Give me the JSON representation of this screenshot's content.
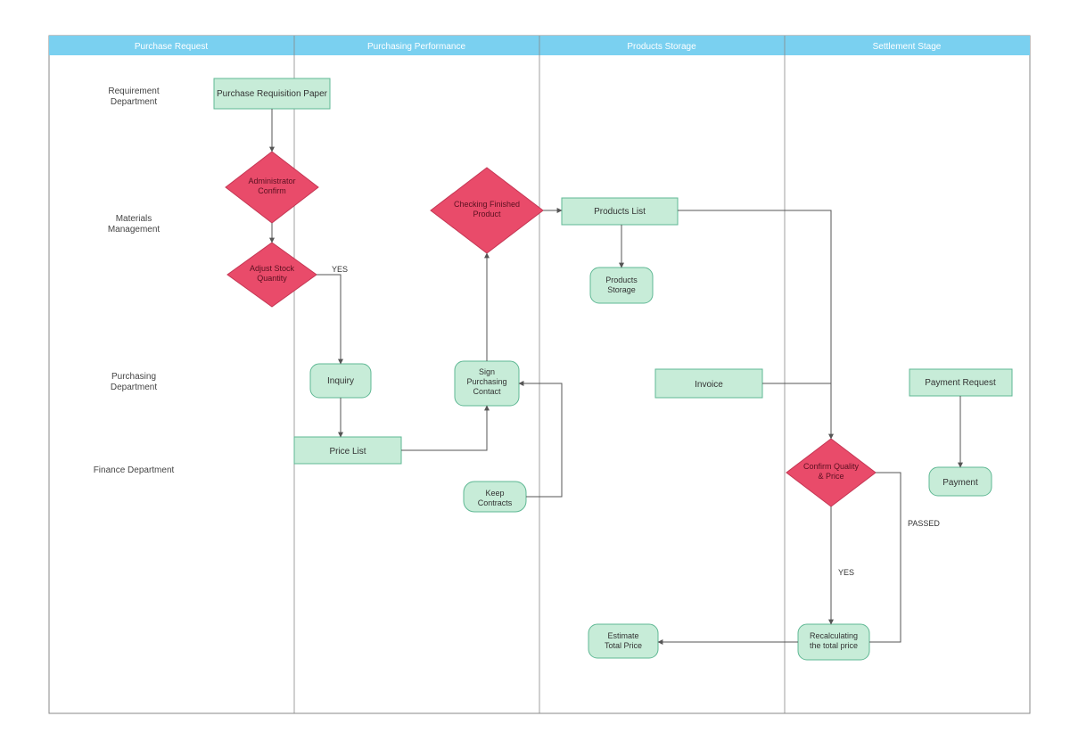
{
  "columns": {
    "c1": "Purchase Request",
    "c2": "Purchasing Performance",
    "c3": "Products Storage",
    "c4": "Settlement Stage"
  },
  "rows": {
    "r1": "Requirement Department",
    "r2": "Materials Management",
    "r3": "Purchasing Department",
    "r4": "Finance Department"
  },
  "nodes": {
    "purchase_requisition": "Purchase Requisition Paper",
    "admin_confirm": "Administrator Confirm",
    "adjust_stock": "Adjust Stock Quantity",
    "inquiry": "Inquiry",
    "price_list": "Price List",
    "sign_contact": "Sign Purchasing Contact",
    "keep_contracts": "Keep Contracts",
    "checking_finished": "Checking Finished Product",
    "products_list": "Products List",
    "products_storage": "Products Storage",
    "invoice": "Invoice",
    "confirm_qp": "Confirm Quality & Price",
    "estimate_total": "Estimate Total Price",
    "recalculating": "Recalculating the total price",
    "payment_request": "Payment Request",
    "payment": "Payment"
  },
  "labels": {
    "yes1": "YES",
    "yes2": "YES",
    "passed": "PASSED"
  },
  "colors": {
    "header": "#7AD0F0",
    "headerText": "#ffffff",
    "process": "#C7ECD8",
    "processStroke": "#5FB894",
    "decision": "#E94B6A",
    "decisionStroke": "#C53754",
    "line": "#555555",
    "border": "#666666"
  }
}
